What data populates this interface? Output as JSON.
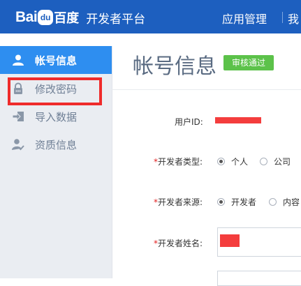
{
  "header": {
    "logo_bai": "Bai",
    "logo_du": "du",
    "logo_cn": "百度",
    "platform": "开发者平台",
    "nav_app_manage": "应用管理",
    "nav_next": "我"
  },
  "sidebar": {
    "items": [
      {
        "label": "帐号信息",
        "icon": "user-icon"
      },
      {
        "label": "修改密码",
        "icon": "lock-icon"
      },
      {
        "label": "导入数据",
        "icon": "import-icon"
      },
      {
        "label": "资质信息",
        "icon": "certified-user-icon"
      }
    ]
  },
  "main": {
    "title": "帐号信息",
    "status_badge": "审核通过",
    "fields": {
      "user_id_label": "用户ID:",
      "dev_type_label": "开发者类型:",
      "dev_type_options": [
        "个人",
        "公司"
      ],
      "dev_type_selected": "个人",
      "dev_source_label": "开发者来源:",
      "dev_source_options": [
        "开发者",
        "内容"
      ],
      "dev_source_selected": "开发者",
      "dev_name_label": "开发者姓名:",
      "required_mark": "*"
    }
  },
  "colors": {
    "header_bg": "#1d5fbf",
    "active_item": "#2e8ef0",
    "badge": "#5cc24a",
    "highlight": "#ef2b2b",
    "redaction": "#f43d3d"
  }
}
